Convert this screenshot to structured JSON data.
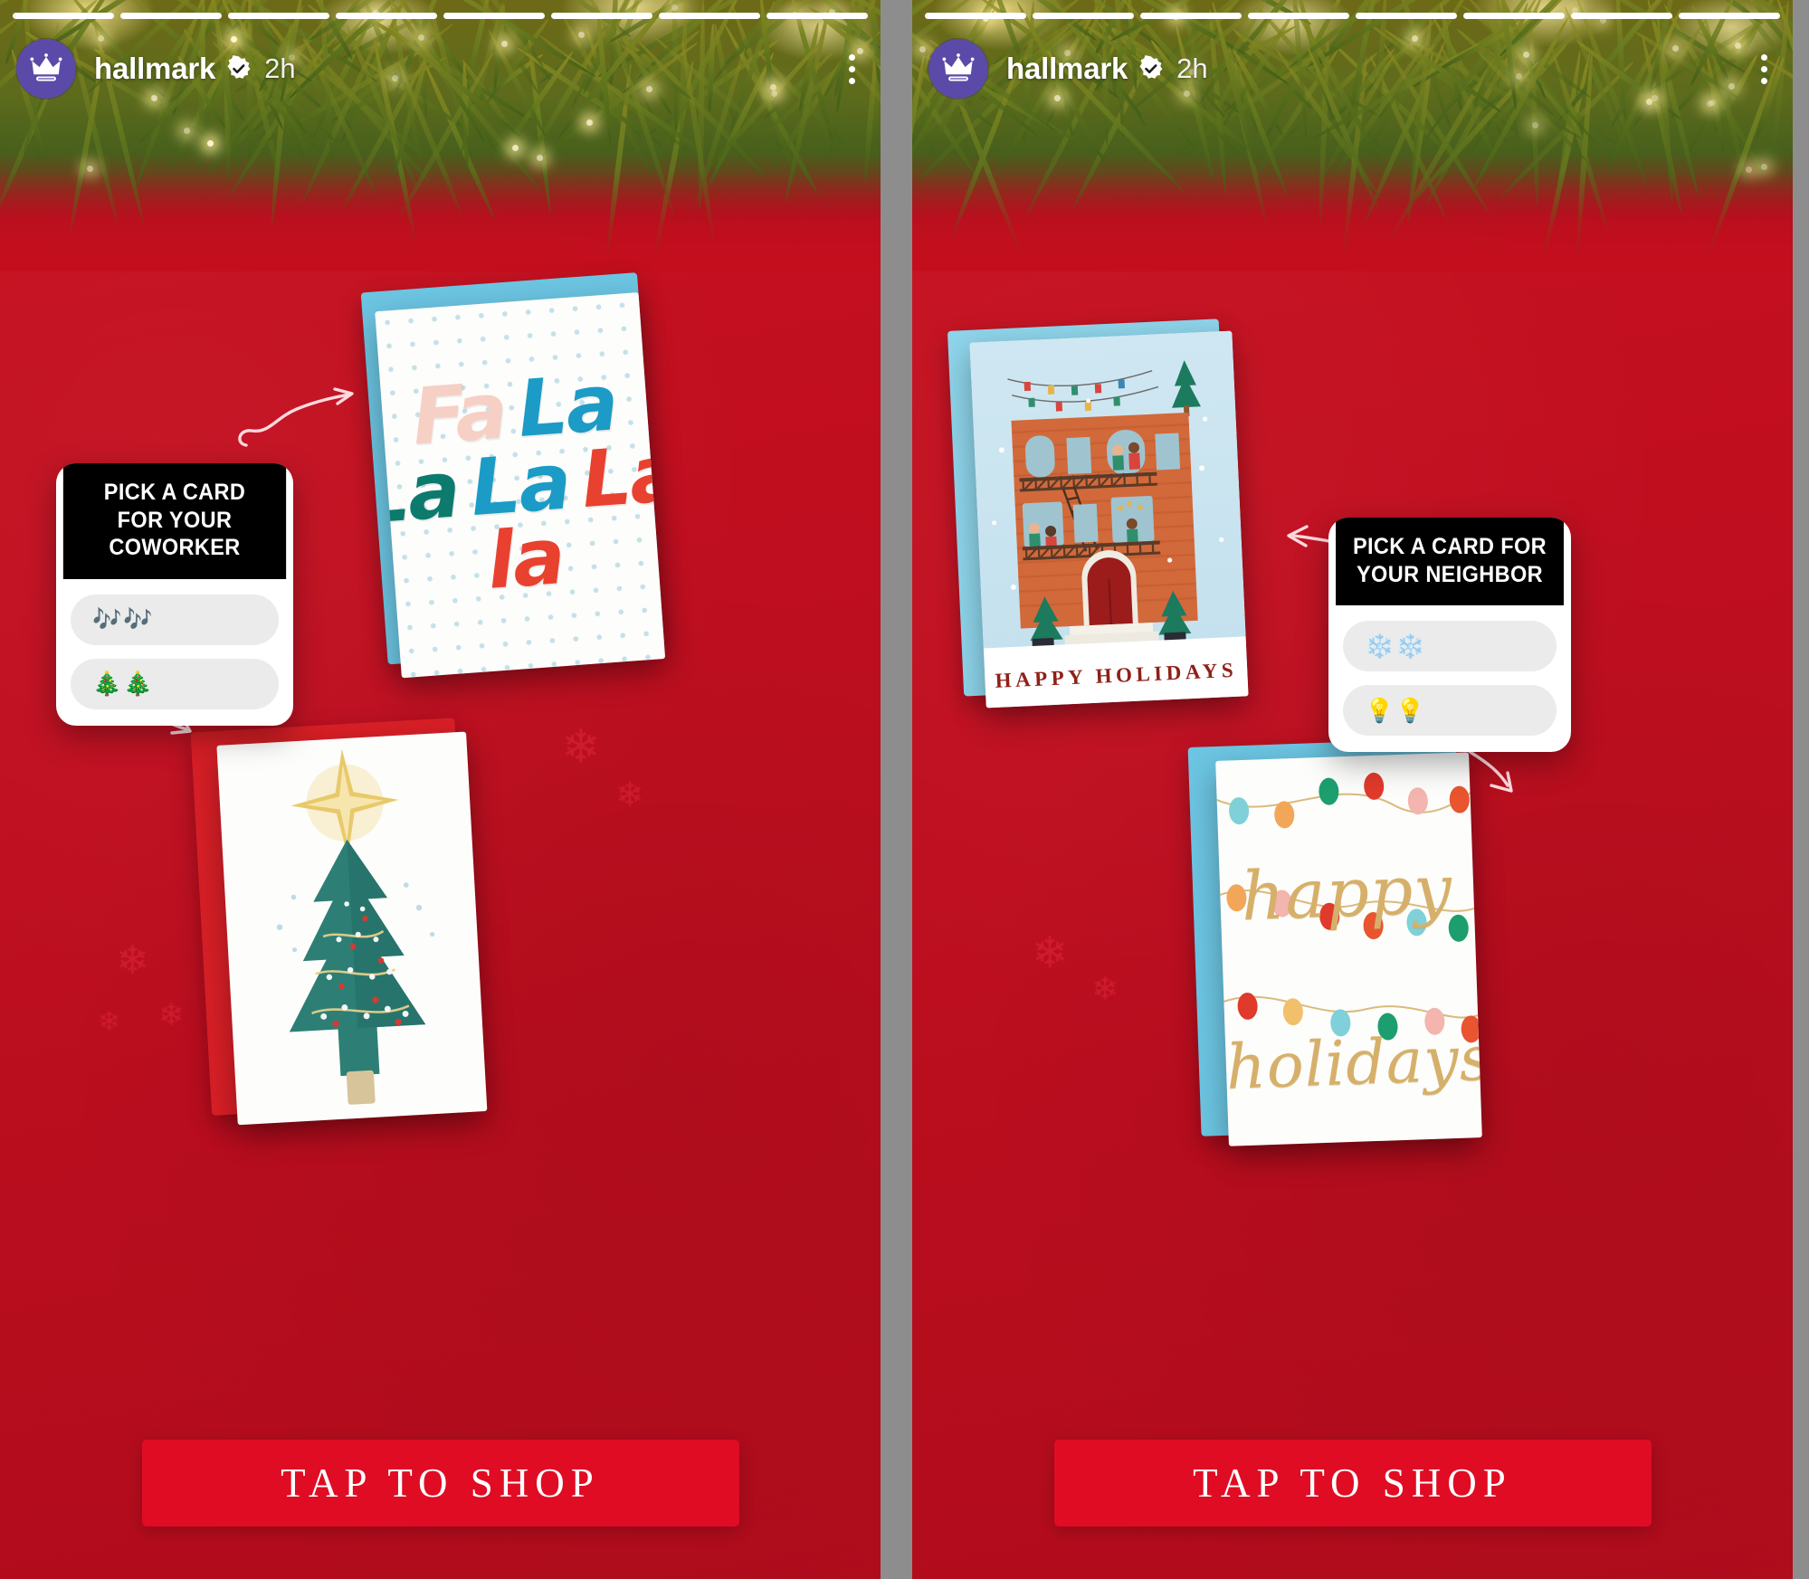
{
  "app": {
    "platform": "instagram-story",
    "background_color": "#c80f21",
    "accent_color": "#e00c23",
    "avatar_color": "#5b4aa8",
    "divider_color": "#8d8d8d"
  },
  "stories": [
    {
      "id": "story-coworker",
      "header": {
        "username": "hallmark",
        "verified": true,
        "timestamp": "2h",
        "avatar_icon": "crown-icon",
        "menu_icon": "kebab-menu-icon",
        "progress_total": 8,
        "progress_filled": 8
      },
      "poll": {
        "question": "PICK A CARD FOR YOUR COWORKER",
        "options": [
          {
            "id": "opt-music-notes",
            "label": "🎶🎶"
          },
          {
            "id": "opt-trees",
            "label": "🎄🎄"
          }
        ]
      },
      "cards": [
        {
          "id": "card-falala",
          "title": "Fa La La La La La",
          "envelope_color": "#6cc5e2",
          "lines": [
            [
              {
                "text": "Fa",
                "color": "#f6cfc5"
              },
              {
                "text": "La",
                "color": "#1b9bc6"
              }
            ],
            [
              {
                "text": "La",
                "color": "#0d7a6e"
              },
              {
                "text": "La",
                "color": "#1b9bc6"
              },
              {
                "text": "La",
                "color": "#e8412f"
              }
            ],
            [
              {
                "text": "la",
                "color": "#e8412f"
              }
            ]
          ]
        },
        {
          "id": "card-tree",
          "title": "Christmas tree card",
          "envelope_color": "#d81f26"
        }
      ],
      "cta": {
        "label": "TAP TO SHOP"
      }
    },
    {
      "id": "story-neighbor",
      "header": {
        "username": "hallmark",
        "verified": true,
        "timestamp": "2h",
        "avatar_icon": "crown-icon",
        "menu_icon": "kebab-menu-icon",
        "progress_total": 8,
        "progress_filled": 8
      },
      "poll": {
        "question": "PICK A CARD FOR YOUR NEIGHBOR",
        "options": [
          {
            "id": "opt-snowflakes",
            "label": "❄️❄️"
          },
          {
            "id": "opt-bulbs",
            "label": "💡💡"
          }
        ]
      },
      "cards": [
        {
          "id": "card-brownstone",
          "title": "Brownstone building card",
          "envelope_color": "#8ed4ea",
          "message": "HAPPY HOLIDAYS"
        },
        {
          "id": "card-lights",
          "title": "String lights card",
          "envelope_color": "#6cc5e2",
          "script_line_1": "happy",
          "script_line_2": "holidays",
          "bulb_colors": [
            "#f2a65a",
            "#e8554a",
            "#7fd0d8",
            "#f3b5ae",
            "#1c9e6f",
            "#e8412f",
            "#f2c06a",
            "#3aa8c4"
          ]
        }
      ],
      "cta": {
        "label": "TAP TO SHOP"
      }
    }
  ]
}
